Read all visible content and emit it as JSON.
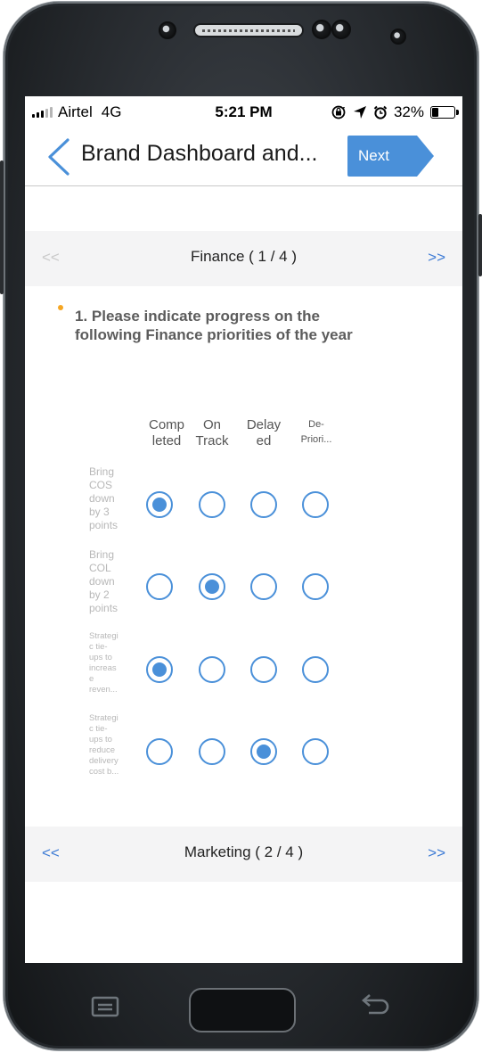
{
  "status": {
    "carrier": "Airtel",
    "network": "4G",
    "time": "5:21 PM",
    "battery_percent": "32%",
    "battery_level": 0.32,
    "icons": [
      "lock-rotation-icon",
      "location-arrow-icon",
      "alarm-icon",
      "battery-icon"
    ]
  },
  "navbar": {
    "title": "Brand Dashboard and...",
    "next_label": "Next",
    "accent": "#4a90d9"
  },
  "sections": {
    "finance": {
      "prev": "<<",
      "title": "Finance ( 1 / 4 )",
      "next": ">>",
      "prev_color": "#c9c9c9",
      "next_color": "#3d7bd5"
    },
    "marketing": {
      "prev": "<<",
      "title": "Marketing ( 2 / 4 )",
      "next": ">>",
      "prev_color": "#3d7bd5",
      "next_color": "#3d7bd5"
    }
  },
  "question": {
    "text": "1. Please indicate progress on the following Finance priorities of the year"
  },
  "matrix": {
    "columns": [
      "Comp leted",
      "On Track",
      "Delay ed",
      "De- Priori..."
    ],
    "rows": [
      {
        "label": "Bring COS down by 3 points",
        "selected": 0
      },
      {
        "label": "Bring COL down by 2 points",
        "selected": 1
      },
      {
        "label": "Strategi c tie- ups to increas e reven...",
        "selected": 0
      },
      {
        "label": "Strategi c tie- ups to reduce delivery cost b...",
        "selected": 2
      }
    ]
  },
  "device": {
    "icons": [
      "speaker-grille",
      "front-camera-icon",
      "home-button",
      "menu-key-icon",
      "back-key-icon"
    ]
  }
}
